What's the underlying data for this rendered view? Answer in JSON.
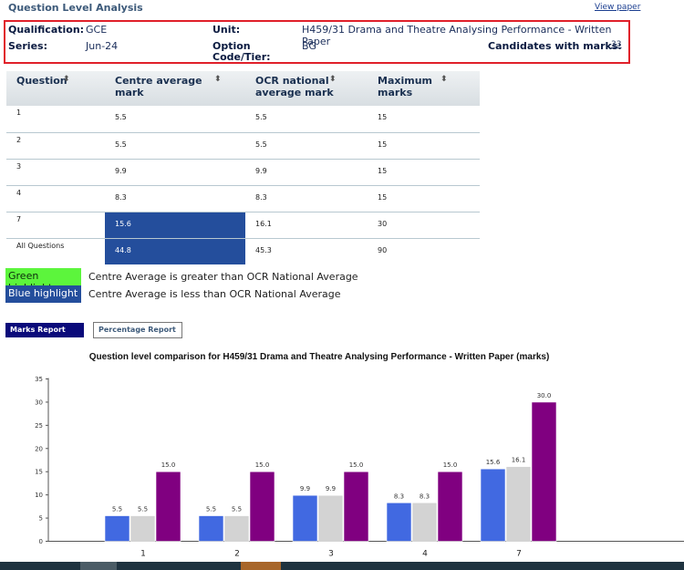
{
  "page": {
    "title": "Question Level Analysis",
    "view_paper_link": "View paper"
  },
  "info": {
    "qualification_label": "Qualification:",
    "qualification_value": "GCE",
    "unit_label": "Unit:",
    "unit_value": "H459/31 Drama and Theatre Analysing Performance - Written Paper",
    "series_label": "Series:",
    "series_value": "Jun-24",
    "option_label_line1": "Option",
    "option_label_line2": "Code/Tier:",
    "option_value": "BG",
    "candidates_label": "Candidates with marks:",
    "candidates_value": "33"
  },
  "table": {
    "headers": [
      {
        "line1": "Question",
        "line2": ""
      },
      {
        "line1": "Centre average",
        "line2": "mark"
      },
      {
        "line1": "OCR national",
        "line2": "average mark"
      },
      {
        "line1": "Maximum",
        "line2": "marks"
      }
    ],
    "sort_icon": "⬍",
    "rows": [
      {
        "question": "1",
        "centre": "5.5",
        "national": "5.5",
        "max": "15",
        "highlight": "none"
      },
      {
        "question": "2",
        "centre": "5.5",
        "national": "5.5",
        "max": "15",
        "highlight": "none"
      },
      {
        "question": "3",
        "centre": "9.9",
        "national": "9.9",
        "max": "15",
        "highlight": "none"
      },
      {
        "question": "4",
        "centre": "8.3",
        "national": "8.3",
        "max": "15",
        "highlight": "none"
      },
      {
        "question": "7",
        "centre": "15.6",
        "national": "16.1",
        "max": "30",
        "highlight": "blue"
      },
      {
        "question": "All Questions",
        "centre": "44.8",
        "national": "45.3",
        "max": "90",
        "highlight": "blue"
      }
    ]
  },
  "legend": {
    "green_label": "Green highlight",
    "green_text": "Centre Average is greater than OCR National Average",
    "blue_label": "Blue highlight",
    "blue_text": "Centre Average is less than OCR National Average",
    "colors": {
      "green": "#5cf53c",
      "blue": "#244e9c"
    }
  },
  "report_buttons": {
    "marks": "Marks Report",
    "percentage": "Percentage Report",
    "active": "marks"
  },
  "chart_data": {
    "type": "bar",
    "title": "Question level comparison for H459/31 Drama and Theatre Analysing Performance - Written Paper (marks)",
    "xlabel": "",
    "ylabel": "",
    "categories": [
      "1",
      "2",
      "3",
      "4",
      "7"
    ],
    "series": [
      {
        "name": "Centre average mark",
        "color": "#4169e1",
        "values": [
          5.5,
          5.5,
          9.9,
          8.3,
          15.6
        ]
      },
      {
        "name": "OCR national average mark",
        "color": "#d3d3d3",
        "values": [
          5.5,
          5.5,
          9.9,
          8.3,
          16.1
        ]
      },
      {
        "name": "Maximum marks",
        "color": "#800080",
        "values": [
          15.0,
          15.0,
          15.0,
          15.0,
          30.0
        ]
      }
    ],
    "yticks": [
      0,
      5,
      10,
      15,
      20,
      25,
      30,
      35
    ],
    "ylim": [
      0,
      35
    ],
    "grid": false,
    "legend": "none",
    "label_format": "one-decimal"
  }
}
